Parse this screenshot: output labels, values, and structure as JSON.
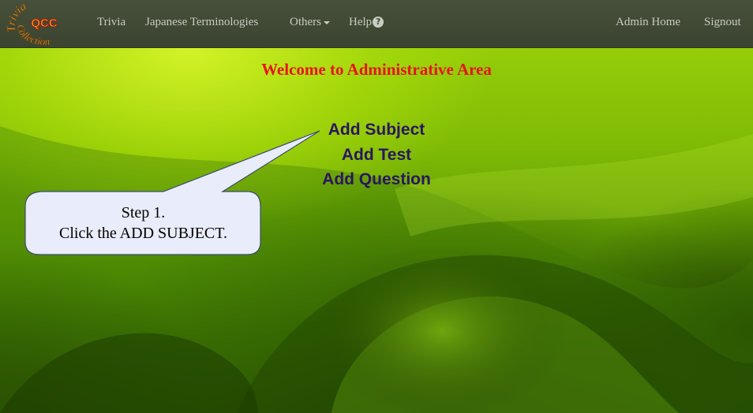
{
  "nav": {
    "logo_letters": "QCC",
    "logo_arc_text": "Trivia Collection",
    "items": [
      {
        "label": "Trivia"
      },
      {
        "label": "Japanese Terminologies"
      },
      {
        "label": "Others"
      },
      {
        "label": "Help"
      }
    ],
    "help_icon": "question-circle-icon",
    "right_items": [
      {
        "label": "Admin Home"
      },
      {
        "label": "Signout"
      }
    ]
  },
  "main": {
    "welcome": "Welcome to Administrative Area",
    "links": [
      {
        "label": "Add Subject"
      },
      {
        "label": "Add Test"
      },
      {
        "label": "Add Question"
      }
    ]
  },
  "callout": {
    "line1": "Step 1.",
    "line2": "Click the ADD SUBJECT."
  },
  "colors": {
    "navbar": "#3f4935",
    "nav_text": "#c9cdc2",
    "welcome": "#e8141c",
    "links": "#2a1560",
    "callout_fill": "#e9ecfb"
  }
}
